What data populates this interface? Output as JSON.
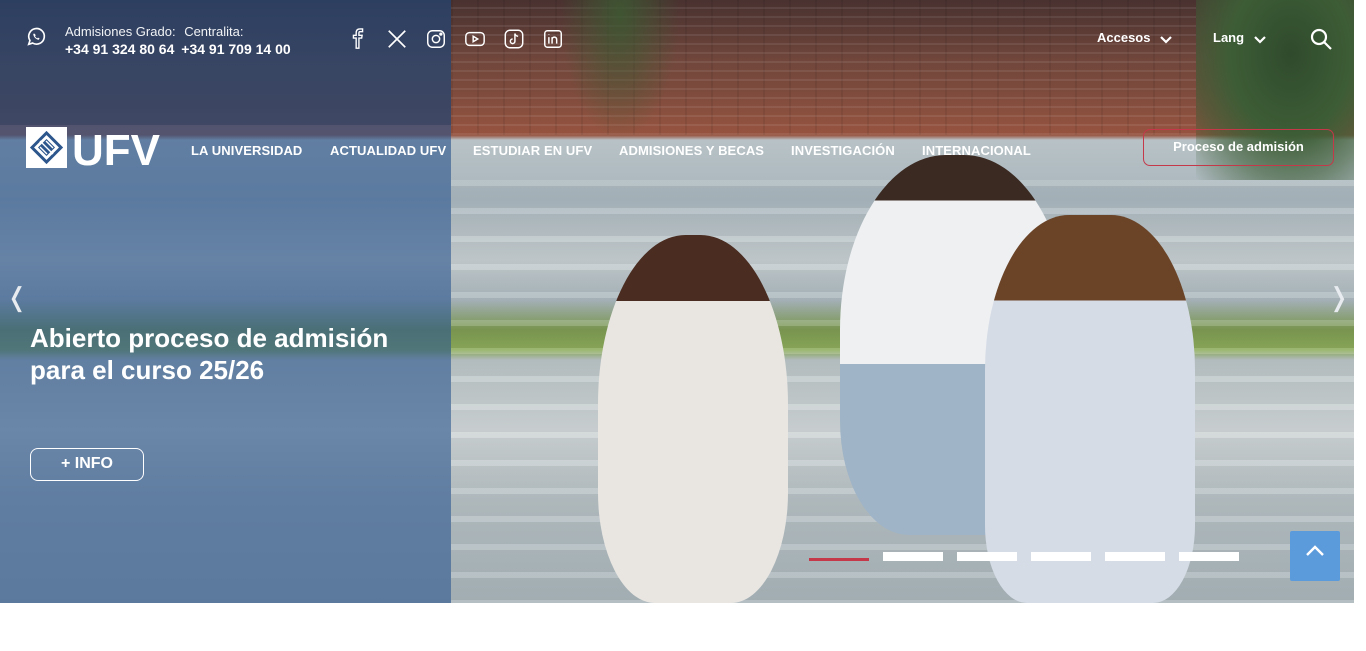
{
  "topbar": {
    "admissions_label": "Admisiones Grado:",
    "switchboard_label": "Centralita:",
    "admissions_phone": "+34 91 324 80 64",
    "switchboard_phone": "+34 91 709 14 00",
    "social_icons": [
      "facebook-icon",
      "x-twitter-icon",
      "instagram-icon",
      "youtube-icon",
      "tiktok-icon",
      "linkedin-icon"
    ],
    "accesos_label": "Accesos",
    "lang_label": "Lang"
  },
  "brand": {
    "logo_text": "UFV"
  },
  "nav": {
    "items": [
      "LA UNIVERSIDAD",
      "ACTUALIDAD UFV",
      "ESTUDIAR EN UFV",
      "ADMISIONES Y BECAS",
      "INVESTIGACIÓN",
      "INTERNACIONAL"
    ],
    "cta_label": "Proceso de admisión"
  },
  "hero": {
    "headline": "Abierto proceso de admisión para el curso 25/26",
    "info_button": "+ INFO",
    "prev_arrow": "❬",
    "next_arrow": "❭",
    "slide_count": 6,
    "active_slide": 1
  },
  "colors": {
    "accent": "#c4384a",
    "panel_blue": "#2c568c",
    "scroll_top_bg": "#5b9bdc"
  }
}
